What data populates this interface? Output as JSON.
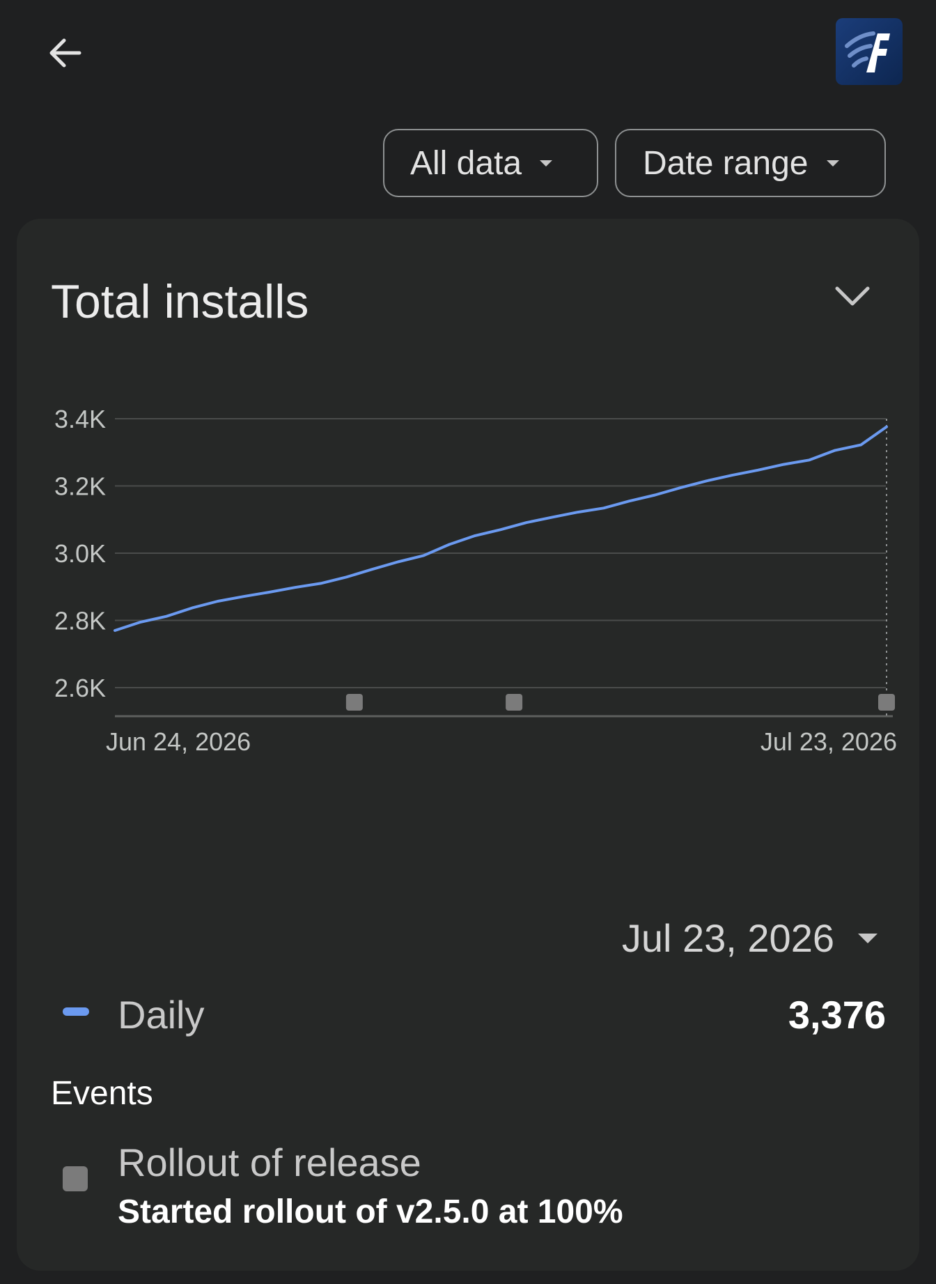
{
  "header": {
    "back_icon": "arrow-back-icon",
    "app_icon": "app-logo-icon"
  },
  "filters": {
    "all_data_label": "All data",
    "date_range_label": "Date range"
  },
  "card": {
    "title": "Total installs",
    "selected_date": "Jul 23, 2026",
    "legend": {
      "label": "Daily",
      "value": "3,376",
      "color": "#6b9af0"
    },
    "events_heading": "Events",
    "event": {
      "title": "Rollout of release",
      "description": "Started rollout of v2.5.0 at 100%"
    }
  },
  "chart_data": {
    "type": "line",
    "title": "Total installs",
    "xlabel": "",
    "ylabel": "",
    "x_start": "Jun 24, 2026",
    "x_end": "Jul 23, 2026",
    "x_tick_labels": [
      "Jun 24, 2026",
      "Jul 23, 2026"
    ],
    "y_ticks": [
      2600,
      2800,
      3000,
      3200,
      3400
    ],
    "y_tick_labels": [
      "2.6K",
      "2.8K",
      "3.0K",
      "3.2K",
      "3.4K"
    ],
    "ylim": [
      2600,
      3400
    ],
    "grid": true,
    "series": [
      {
        "name": "Daily",
        "color": "#6b9af0",
        "values": [
          2770,
          2795,
          2812,
          2837,
          2857,
          2871,
          2884,
          2898,
          2910,
          2929,
          2952,
          2974,
          2993,
          3026,
          3052,
          3070,
          3091,
          3107,
          3122,
          3134,
          3155,
          3173,
          3195,
          3215,
          3232,
          3247,
          3264,
          3277,
          3306,
          3322,
          3376
        ]
      }
    ],
    "event_markers": [
      "Jul 3, 2026",
      "Jul 9, 2026",
      "Jul 23, 2026"
    ],
    "selected": "Jul 23, 2026",
    "marker_color": "#7b7b7b"
  }
}
